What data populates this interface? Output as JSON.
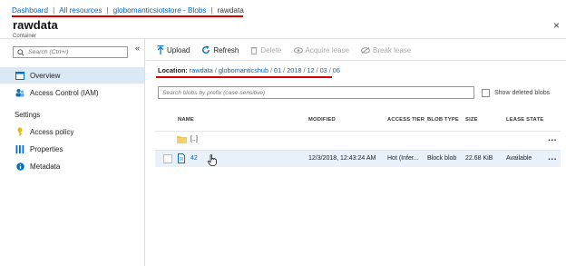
{
  "breadcrumb": [
    "Dashboard",
    "All resources",
    "globomanticsiotstore - Blobs",
    "rawdata"
  ],
  "header": {
    "title": "rawdata",
    "subtitle": "Container"
  },
  "sidebar": {
    "search_placeholder": "Search (Ctrl+/)",
    "collapse": "«",
    "items": [
      {
        "label": "Overview",
        "icon": "overview-icon",
        "active": true
      },
      {
        "label": "Access Control (IAM)",
        "icon": "iam-icon",
        "active": false
      }
    ],
    "section": "Settings",
    "settings_items": [
      {
        "label": "Access policy",
        "icon": "key-icon"
      },
      {
        "label": "Properties",
        "icon": "properties-icon"
      },
      {
        "label": "Metadata",
        "icon": "info-icon"
      }
    ]
  },
  "toolbar": {
    "upload": "Upload",
    "refresh": "Refresh",
    "delete": "Delete",
    "acquire_lease": "Acquire lease",
    "break_lease": "Break lease"
  },
  "location": {
    "label": "Location:",
    "path": [
      "rawdata",
      "globomanticshub",
      "01",
      "2018",
      "12",
      "03",
      "06"
    ]
  },
  "blob_search": {
    "placeholder": "Search blobs by prefix (case-sensitive)"
  },
  "show_deleted": "Show deleted blobs",
  "columns": [
    "NAME",
    "MODIFIED",
    "ACCESS TIER",
    "BLOB TYPE",
    "SIZE",
    "LEASE STATE"
  ],
  "rows": [
    {
      "name": "[..]",
      "type": "folder",
      "modified": "",
      "tier": "",
      "blob_type": "",
      "size": "",
      "lease": ""
    },
    {
      "name": "42",
      "type": "file",
      "modified": "12/3/2018, 12:43:24 AM",
      "tier": "Hot (Infer...",
      "blob_type": "Block blob",
      "size": "22.68 KiB",
      "lease": "Available"
    }
  ],
  "more": "...",
  "close": "×",
  "colors": {
    "link": "#0066b8",
    "highlight": "#d40000",
    "selected": "#dbe8f5"
  }
}
